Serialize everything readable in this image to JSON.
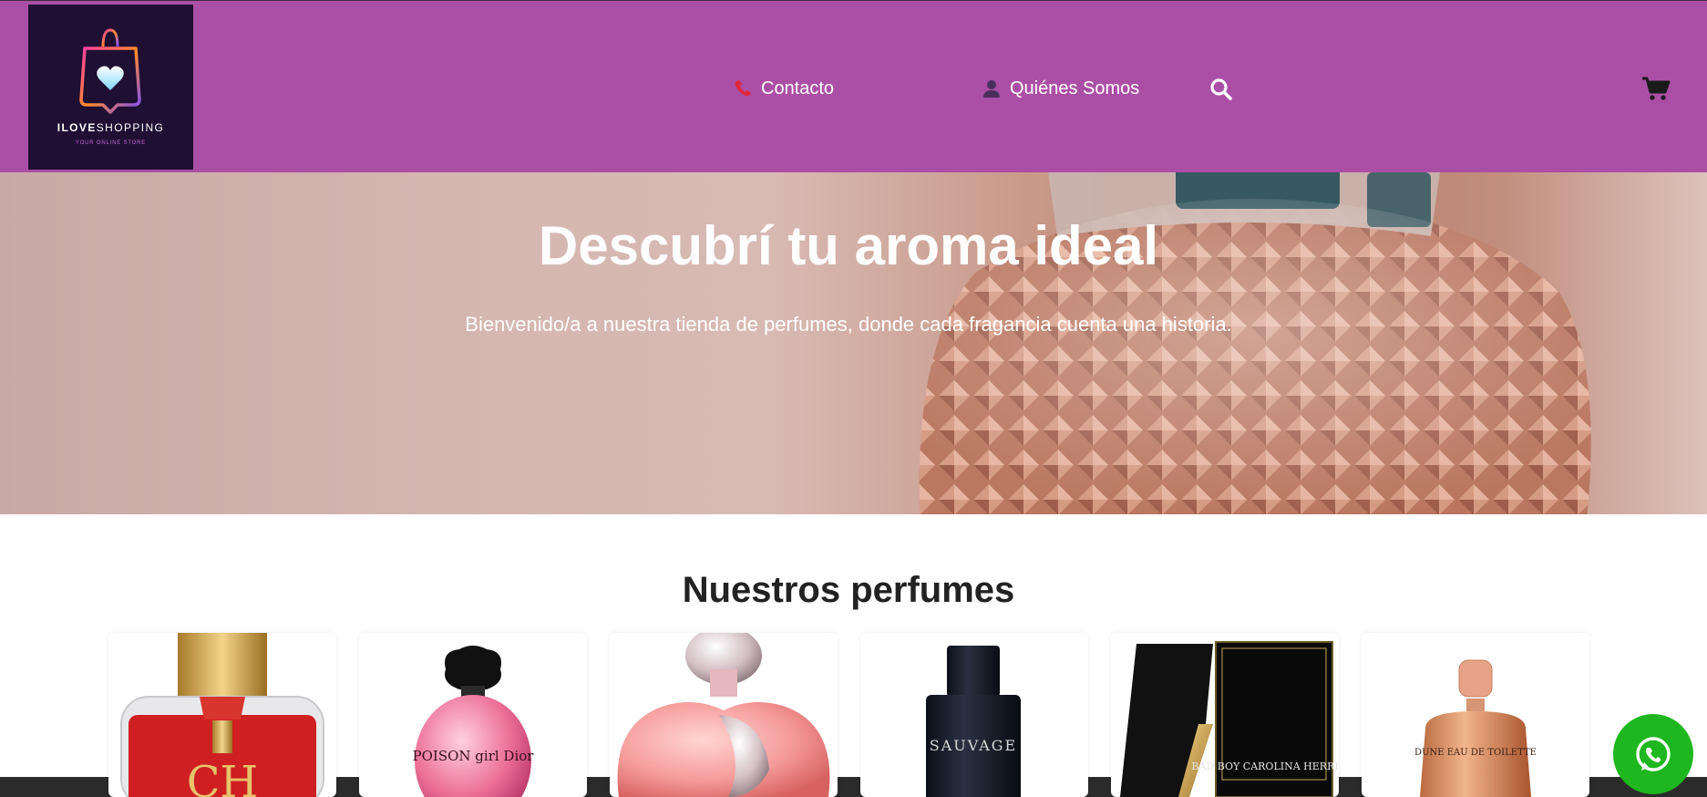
{
  "brand": {
    "name_bold": "ILOVE",
    "name_rest": "SHOPPING",
    "tagline": "YOUR ONLINE STORE"
  },
  "nav": {
    "contact_label": "Contacto",
    "about_label": "Quiénes Somos",
    "icons": [
      "phone-icon",
      "user-icon",
      "search-icon",
      "cart-icon"
    ]
  },
  "hero": {
    "title": "Descubrí tu aroma ideal",
    "subtitle": "Bienvenido/a a nuestra tienda de perfumes, donde cada fragancia cuenta una historia."
  },
  "products": {
    "title": "Nuestros perfumes",
    "items": [
      {
        "label": "CH"
      },
      {
        "label": "POISON girl Dior"
      },
      {
        "label": ""
      },
      {
        "label": "SAUVAGE"
      },
      {
        "label": "BAD BOY CAROLINA HERRERA"
      },
      {
        "label": "DUNE EAU DE TOILETTE"
      }
    ]
  },
  "colors": {
    "header": "#ab4fa6",
    "logo_bg": "#1f0f33",
    "whatsapp": "#1fb71f"
  }
}
